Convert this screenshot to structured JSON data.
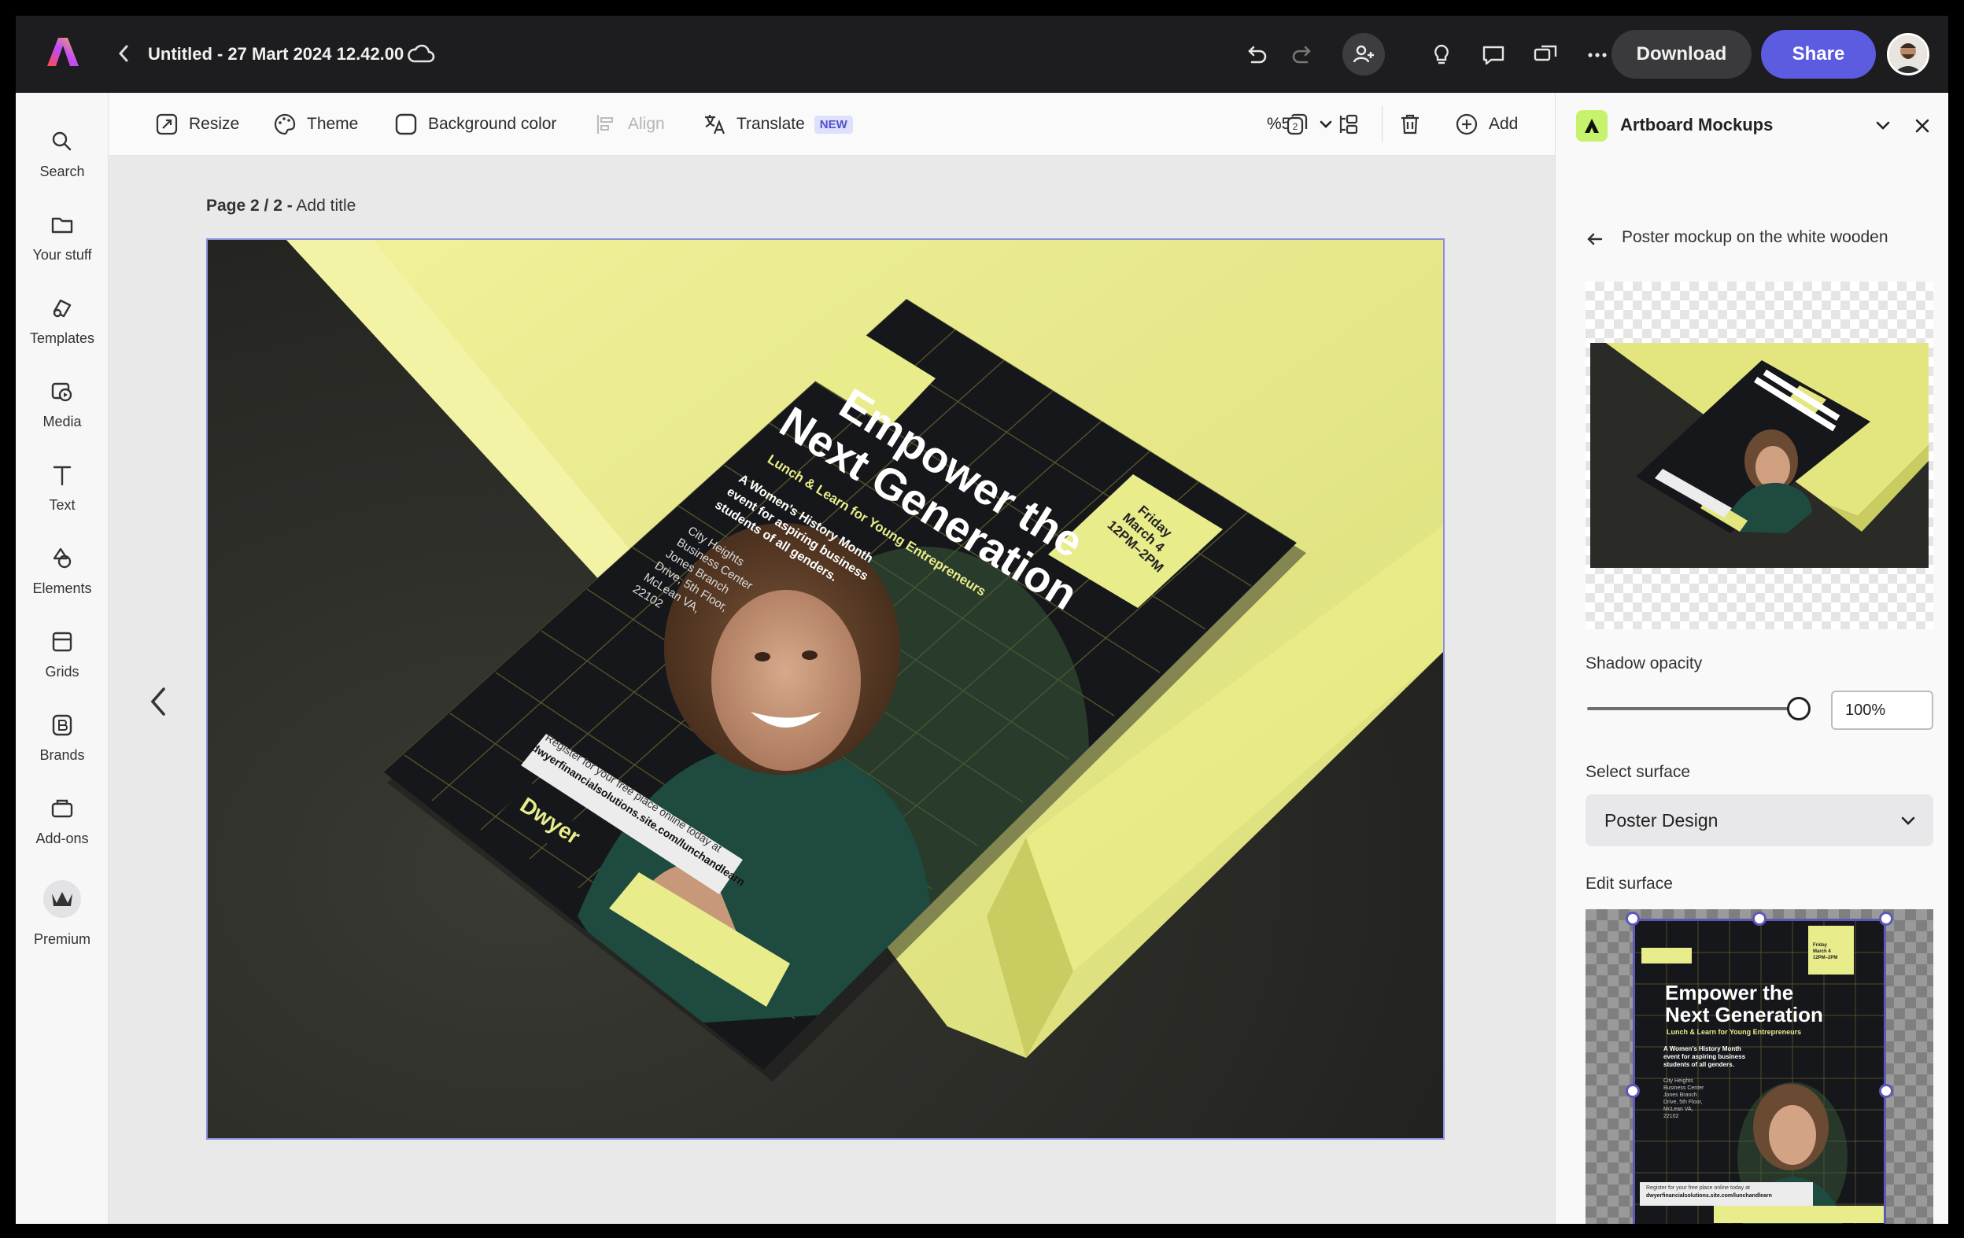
{
  "app": {
    "document_title": "Untitled - 27 Mart 2024 12.42.00",
    "download_label": "Download",
    "share_label": "Share"
  },
  "sidebar": {
    "items": [
      {
        "label": "Search",
        "icon": "search-icon"
      },
      {
        "label": "Your stuff",
        "icon": "folder-icon"
      },
      {
        "label": "Templates",
        "icon": "templates-icon"
      },
      {
        "label": "Media",
        "icon": "media-icon"
      },
      {
        "label": "Text",
        "icon": "text-icon"
      },
      {
        "label": "Elements",
        "icon": "elements-icon"
      },
      {
        "label": "Grids",
        "icon": "grids-icon"
      },
      {
        "label": "Brands",
        "icon": "brands-icon"
      },
      {
        "label": "Add-ons",
        "icon": "addons-icon"
      },
      {
        "label": "Premium",
        "icon": "crown-icon"
      }
    ]
  },
  "toolbar": {
    "resize": "Resize",
    "theme": "Theme",
    "background_color": "Background color",
    "align": "Align",
    "translate": "Translate",
    "new_badge": "NEW",
    "zoom": "%50",
    "add": "Add"
  },
  "canvas": {
    "page_number": "Page 2 / 2 -",
    "page_title_placeholder": "Add title"
  },
  "poster": {
    "headline_1": "Empower the",
    "headline_2": "Next Generation",
    "subhead": "Lunch & Learn for Young Entrepreneurs",
    "desc_1": "A Women's History Month",
    "desc_2": "event for aspiring business",
    "desc_3": "students of all genders.",
    "addr_1": "City Heights",
    "addr_2": "Business Center",
    "addr_3": "Jones Branch",
    "addr_4": "Drive, 5th Floor,",
    "addr_5": "McLean VA,",
    "addr_6": "22102",
    "date_1": "Friday",
    "date_2": "March 4",
    "date_3": "12PM–2PM",
    "register_1": "Register for your free place online today at",
    "register_2": "dwyerfinancialsolutions.site.com/lunchandlearn",
    "brand": "Dwyer"
  },
  "panel": {
    "title": "Artboard Mockups",
    "subtitle": "Poster mockup on the white wooden",
    "shadow_opacity_label": "Shadow opacity",
    "shadow_opacity_value": "100%",
    "shadow_opacity_fraction": 1.0,
    "select_surface_label": "Select surface",
    "surface_value": "Poster Design",
    "edit_surface_label": "Edit surface"
  },
  "colors": {
    "accent": "#5c5ce0",
    "poster_yellow": "#e8ec8a",
    "poster_dark": "#15171a",
    "selection": "#8d8de6"
  }
}
